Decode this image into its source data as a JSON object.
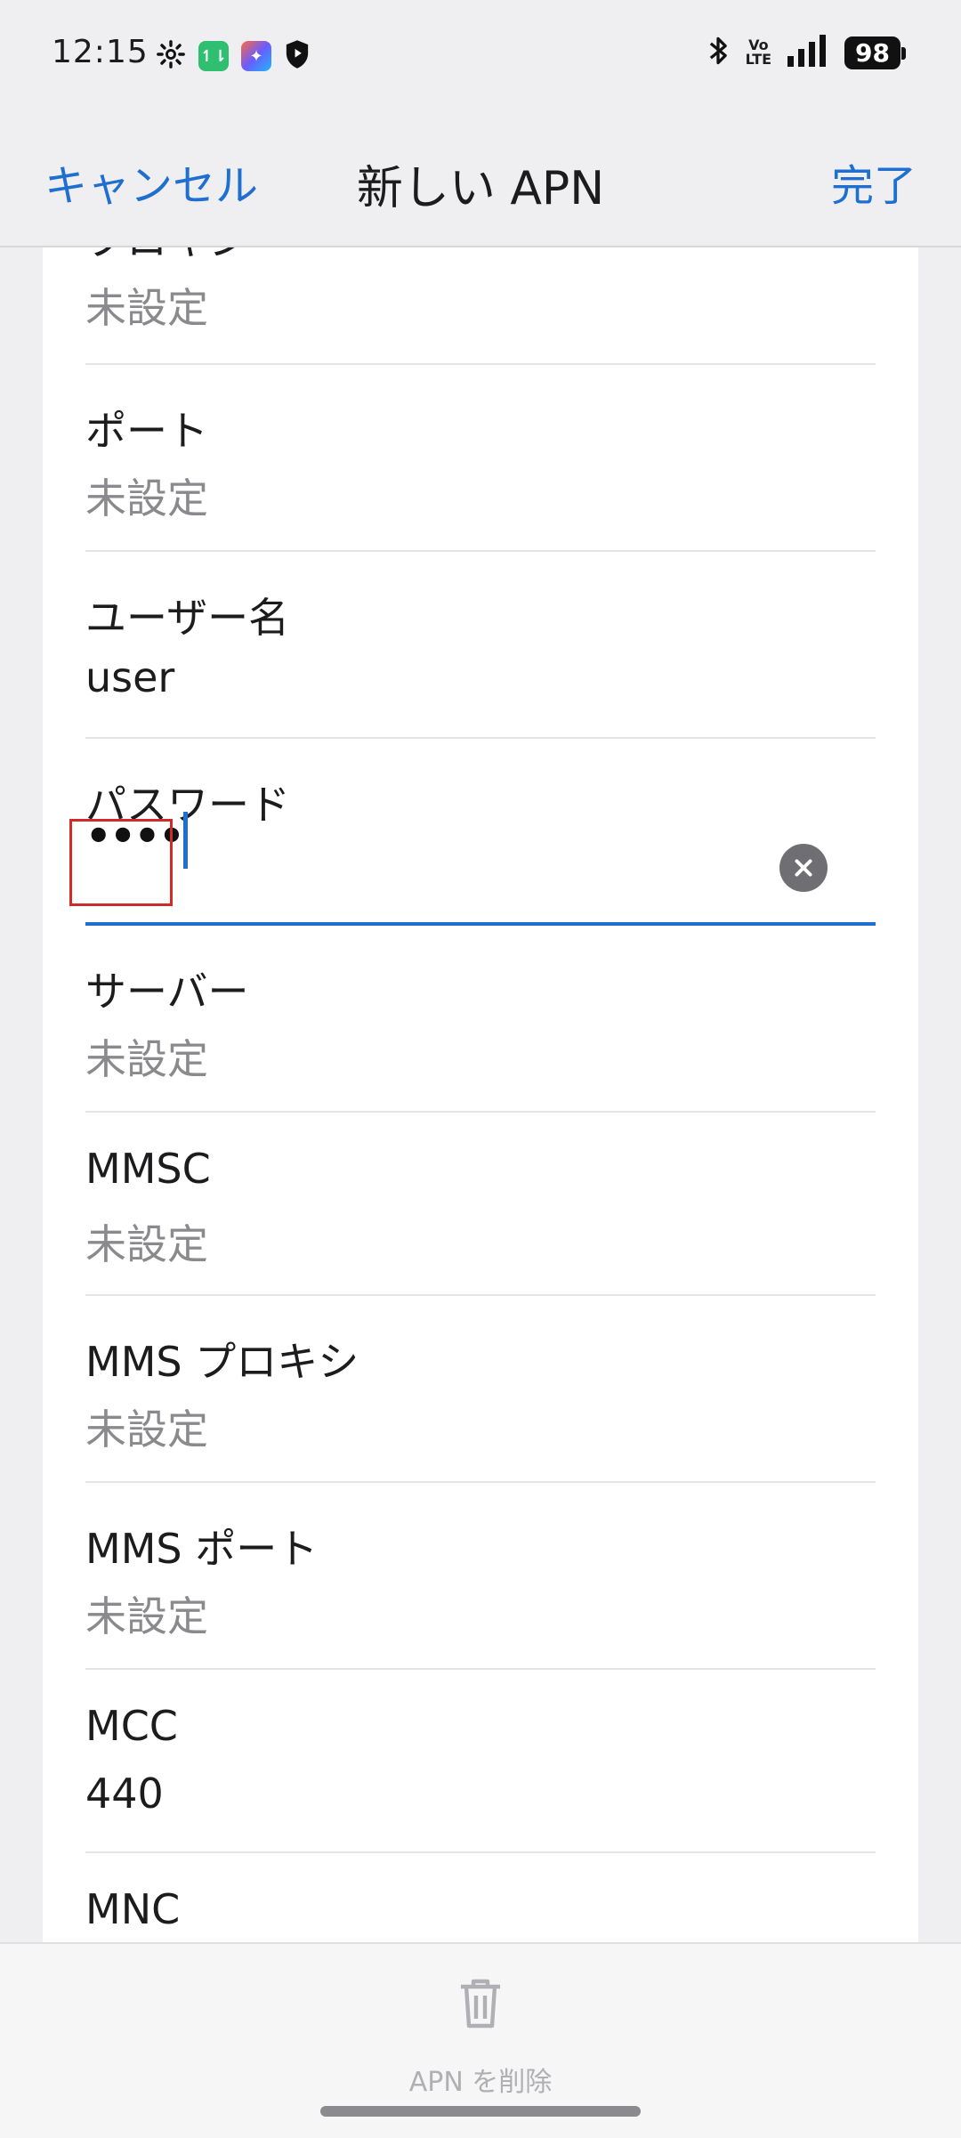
{
  "status_bar": {
    "time": "12:15",
    "icons": [
      "gear-icon",
      "app-green-icon",
      "app-colorful-icon",
      "shield-icon",
      "bluetooth-icon",
      "volte-icon",
      "signal-icon"
    ],
    "volte_top": "Vo",
    "volte_bottom": "LTE",
    "battery": "98"
  },
  "header": {
    "cancel_label": "キャンセル",
    "title": "新しい APN",
    "done_label": "完了"
  },
  "fields": [
    {
      "label": "プロキシ",
      "value": "未設定"
    },
    {
      "label": "ポート",
      "value": "未設定"
    },
    {
      "label": "ユーザー名",
      "value": "user"
    },
    {
      "label": "パスワード",
      "value": "••••"
    },
    {
      "label": "サーバー",
      "value": "未設定"
    },
    {
      "label": "MMSC",
      "value": "未設定"
    },
    {
      "label": "MMS プロキシ",
      "value": "未設定"
    },
    {
      "label": "MMS ポート",
      "value": "未設定"
    },
    {
      "label": "MCC",
      "value": "440"
    },
    {
      "label": "MNC",
      "value": ""
    }
  ],
  "bottom": {
    "delete_label": "APN を削除"
  },
  "colors": {
    "accent": "#1f6fd0",
    "highlight_box": "#d02b2b",
    "placeholder_gray": "#8a8a8e"
  }
}
